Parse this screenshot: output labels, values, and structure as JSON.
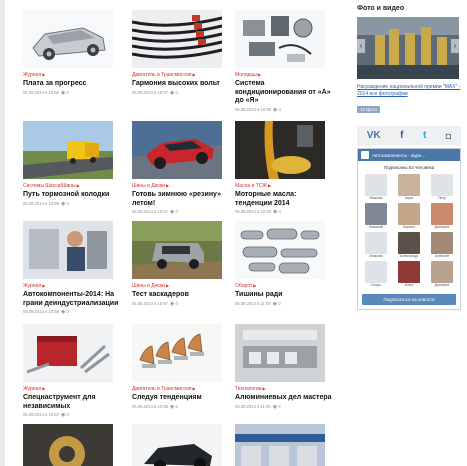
{
  "articles": [
    {
      "cat": "Журнал",
      "title": "Плата за прогресс",
      "meta": "05.08.2014 в 10:56",
      "views": "0"
    },
    {
      "cat": "Двигатель и Трансмиссия",
      "title": "Гармония высоких вольт",
      "meta": "05.08.2014 в 10:57",
      "views": "0"
    },
    {
      "cat": "Молодцы",
      "title": "Система кондиционирования от «А» до «Я»",
      "meta": "05.08.2014 в 10:58",
      "views": "0"
    },
    {
      "cat": "Системы Шасси/Шины",
      "title": "Путь тормозной колодки",
      "meta": "05.08.2014 в 10:59",
      "views": "0"
    },
    {
      "cat": "Шины и Диски",
      "title": "Готовь зимнюю «резину» летом!",
      "meta": "05.08.2014 в 10:57",
      "views": "0"
    },
    {
      "cat": "Масла и ТСЖ",
      "title": "Моторные масла: тенденции 2014",
      "meta": "05.08.2014 в 10:58",
      "views": "0"
    },
    {
      "cat": "Журнал",
      "title": "Автокомпоненты-2014: На грани деиндустриализации",
      "meta": "05.08.2014 в 10:59",
      "views": "0"
    },
    {
      "cat": "Шины и Диски",
      "title": "Тест каскадеров",
      "meta": "05.08.2014 в 10:57",
      "views": "0"
    },
    {
      "cat": "Оборот",
      "title": "Тишины ради",
      "meta": "05.08.2014 в 11:00",
      "views": "0"
    },
    {
      "cat": "Журнал",
      "title": "Спецнаструмент для независимых",
      "meta": "05.08.2014 в 10:57",
      "views": "0"
    },
    {
      "cat": "Двигатель и Трансмиссия",
      "title": "Следуя тенденциям",
      "meta": "05.08.2014 в 10:58",
      "views": "0"
    },
    {
      "cat": "Технологии",
      "title": "Алюминиевых дел мастера",
      "meta": "05.08.2014 в 11:00",
      "views": "0"
    }
  ],
  "sidebar": {
    "heading": "Фото и видео",
    "photo_caption": "Награждение национальной премии \"МАХ\" - 2014",
    "photo_caption_suffix": "все фотографии",
    "badge": "10 фото",
    "social": {
      "vk": "VK",
      "fb": "f",
      "tw": "t",
      "ig": "◘"
    },
    "vk_widget": {
      "group_name": "Автокомпоненты - журн...",
      "subscribers": "Подписаны 63 человека",
      "users": [
        "Максим",
        "Кира",
        "Петр",
        "Николай",
        "Кирилл",
        "Дмитрий",
        "Максим",
        "Александр",
        "Алексей",
        "Игорь",
        "Илья",
        "Дмитрий"
      ],
      "button": "Подписаться на новости"
    }
  }
}
